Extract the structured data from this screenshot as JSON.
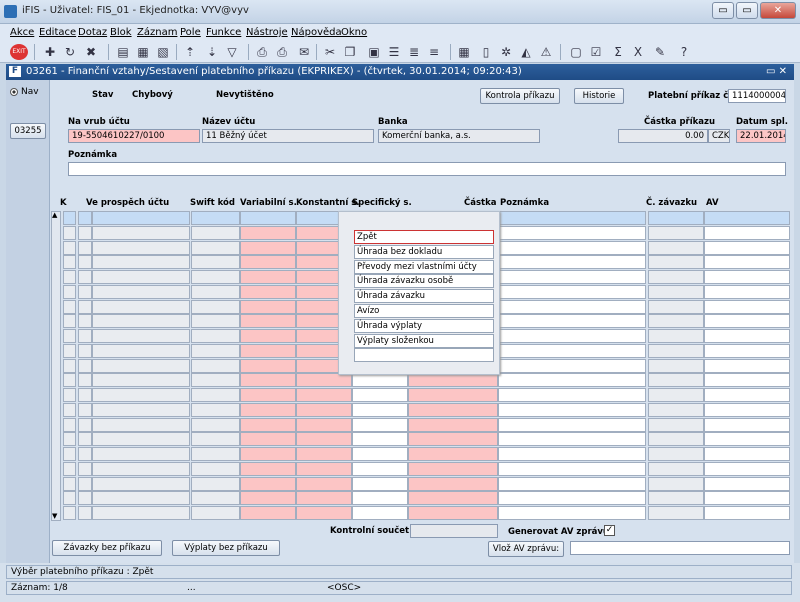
{
  "window": {
    "title": "iFIS - Uživatel: FIS_01 - Ekjednotka: VYV@vyv",
    "min": "▭",
    "max": "▭",
    "close": "✕"
  },
  "menu": [
    "Akce",
    "Editace",
    "Dotaz",
    "Blok",
    "Záznam",
    "Pole",
    "Funkce",
    "Nástroje",
    "Nápověda",
    "Okno"
  ],
  "form": {
    "title": "03261 - Finanční vztahy/Sestavení platebního příkazu (EKPRIKEX) - (čtvrtek, 30.01.2014; 09:20:43)",
    "ctrl": "▭ ✕"
  },
  "left": {
    "nav": "Nav",
    "code": "03255"
  },
  "header": {
    "stav_label": "Stav",
    "stav_value": "Chybový",
    "tisk_value": "Nevytištěno",
    "kontrola_btn": "Kontrola příkazu",
    "historie_btn": "Historie",
    "prikaz_label": "Platební příkaz č.",
    "prikaz_value": "1114000004",
    "na_vrub_label": "Na vrub účtu",
    "na_vrub_value": "19-5504610227/0100",
    "nazev_label": "Název účtu",
    "nazev_value": "11 Běžný účet",
    "banka_label": "Banka",
    "banka_value": "Komerční banka, a.s.",
    "castka_label": "Částka příkazu",
    "castka_value": "0.00",
    "mena_value": "CZK",
    "datum_label": "Datum spl.",
    "datum_value": "22.01.2014",
    "poznamka_label": "Poznámka",
    "poznamka_value": ""
  },
  "table": {
    "headers": {
      "k": "K",
      "ucet": "Ve prospěch účtu",
      "swift": "Swift kód",
      "var": "Variabilní s.",
      "konst": "Konstantní s.",
      "spec": "Specifický s.",
      "castka": "Částka",
      "pozn": "Poznámka",
      "zav": "Č. závazku",
      "av": "AV"
    }
  },
  "popup": {
    "items": [
      "Zpět",
      "Úhrada bez dokladu",
      "Převody mezi vlastními účty",
      "Úhrada závazku osobě",
      "Úhrada závazku",
      "Avízo",
      "Úhrada výplaty",
      "Výplaty složenkou",
      ""
    ]
  },
  "footer": {
    "kontrolni_label": "Kontrolní součet",
    "kontrolni_value": "",
    "gen_av_label": "Generovat AV zprávu",
    "gen_av_check": "✓",
    "vloz_btn": "Vlož AV zprávu:",
    "vloz_value": "",
    "zavazky_btn": "Závazky bez příkazu",
    "vyplaty_btn": "Výplaty bez příkazu"
  },
  "status": {
    "message": "Výběr platebního příkazu : Zpět",
    "record": "Záznam: 1/8",
    "dots": "...",
    "osc": "<OSC>"
  },
  "icons": [
    "exit-icon",
    "add-icon",
    "refresh-icon",
    "delete-icon",
    "folder-icon",
    "folder2-icon",
    "folder3-icon",
    "sort-asc-icon",
    "sort-desc-icon",
    "filter-icon",
    "print-icon",
    "print2-icon",
    "mail-icon",
    "cut-icon",
    "copy-icon",
    "paste-icon",
    "list-icon",
    "list2-icon",
    "list3-icon",
    "calc-icon",
    "doc-icon",
    "settings-icon",
    "chart-icon",
    "warning-icon",
    "form-icon",
    "check-icon",
    "sum-icon",
    "excel-icon",
    "edit-icon",
    "help-icon"
  ],
  "colors": {
    "title_bar": "#1f4c86",
    "pink": "#fcc5c5",
    "blue_row": "#c5dcf5"
  }
}
